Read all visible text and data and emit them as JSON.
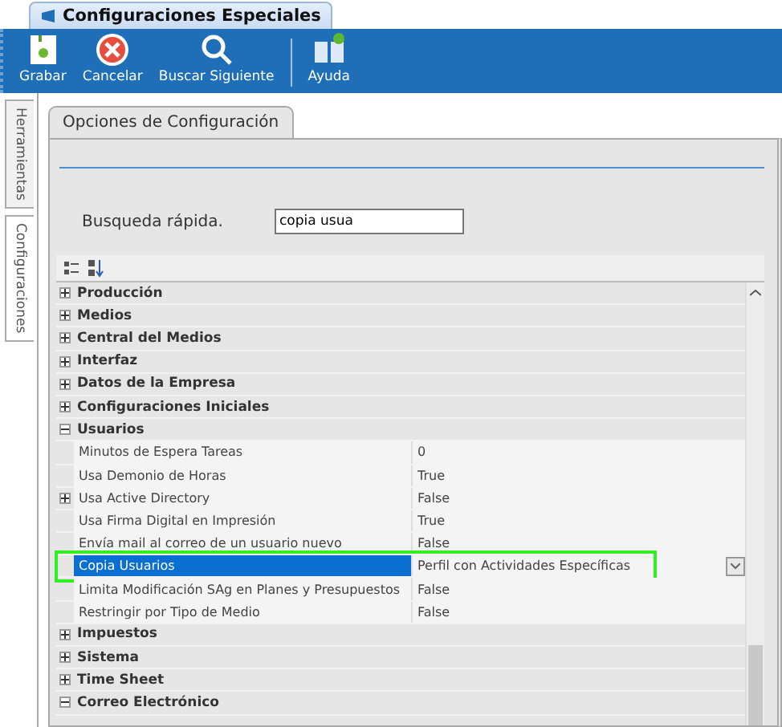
{
  "window": {
    "title": "Configuraciones Especiales"
  },
  "toolbar": [
    {
      "label": "Grabar",
      "kind": "save"
    },
    {
      "label": "Cancelar",
      "kind": "cancel"
    },
    {
      "label": "Buscar Siguiente",
      "kind": "search"
    },
    {
      "label": "Ayuda",
      "kind": "help"
    }
  ],
  "side_tabs": [
    {
      "label": "Herramientas",
      "selected": false
    },
    {
      "label": "Configuraciones",
      "selected": true
    }
  ],
  "panel_tab": {
    "label": "Opciones de Configuración"
  },
  "search": {
    "label": "Busqueda rápida.",
    "value": "copia usua"
  },
  "grid": {
    "rows": [
      {
        "kind": "category",
        "label": "Producción",
        "expanded": false
      },
      {
        "kind": "category",
        "label": "Medios",
        "expanded": false
      },
      {
        "kind": "category",
        "label": "Central del Medios",
        "expanded": false
      },
      {
        "kind": "category",
        "label": "Interfaz",
        "expanded": false
      },
      {
        "kind": "category",
        "label": "Datos de la Empresa",
        "expanded": false
      },
      {
        "kind": "category",
        "label": "Configuraciones Iniciales",
        "expanded": false
      },
      {
        "kind": "category",
        "label": "Usuarios",
        "expanded": true
      },
      {
        "kind": "property",
        "label": "Minutos de Espera Tareas",
        "value": "0",
        "selected": false
      },
      {
        "kind": "property",
        "label": "Usa Demonio de Horas",
        "value": "True",
        "selected": false
      },
      {
        "kind": "property",
        "label": "Usa Active Directory",
        "value": "False",
        "selected": false,
        "expandable": true
      },
      {
        "kind": "property",
        "label": "Usa Firma Digital en Impresión",
        "value": "True",
        "selected": false
      },
      {
        "kind": "property",
        "label": "Envía mail al correo de un usuario nuevo",
        "value": "False",
        "selected": false
      },
      {
        "kind": "property",
        "label": "Copia Usuarios",
        "value": "Perfil con Actividades Específicas",
        "selected": true,
        "highlighted": true
      },
      {
        "kind": "property",
        "label": "Limita Modificación SAg en Planes y Presupuestos",
        "value": "False",
        "selected": false
      },
      {
        "kind": "property",
        "label": "Restringir por Tipo de Medio",
        "value": "False",
        "selected": false
      },
      {
        "kind": "category",
        "label": "Impuestos",
        "expanded": false
      },
      {
        "kind": "category",
        "label": "Sistema",
        "expanded": false
      },
      {
        "kind": "category",
        "label": "Time Sheet",
        "expanded": false
      },
      {
        "kind": "category",
        "label": "Correo Electrónico",
        "expanded": true
      }
    ]
  }
}
